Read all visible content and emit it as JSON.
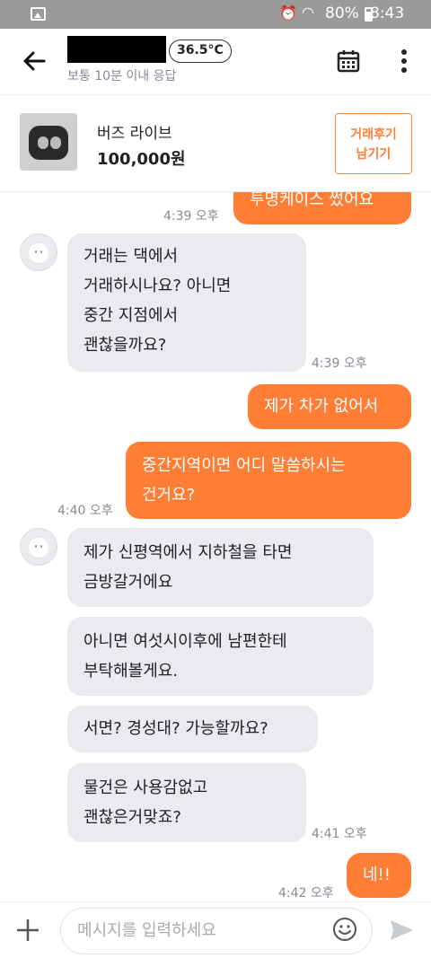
{
  "status_bar": {
    "battery": "80%",
    "time": "8:43"
  },
  "header": {
    "temperature": "36.5°C",
    "response_time": "보통 10분 이내 응답"
  },
  "product": {
    "title": "버즈 라이브",
    "price": "100,000원",
    "review_button": [
      "거래후기",
      "남기기"
    ]
  },
  "messages": [
    {
      "sender": "me",
      "lines": [
        "투명케이스 썼어요"
      ],
      "time": "4:39 오후"
    },
    {
      "sender": "them",
      "lines": [
        "거래는 댁에서",
        "거래하시나요? 아니면",
        "중간 지점에서",
        "괜찮을까요?"
      ],
      "time": "4:39 오후"
    },
    {
      "sender": "me",
      "lines": [
        "제가 차가 없어서"
      ]
    },
    {
      "sender": "me",
      "lines": [
        "중간지역이면 어디 말씀하시는",
        "건거요?"
      ],
      "time": "4:40 오후"
    },
    {
      "sender": "them",
      "lines": [
        "제가 신평역에서 지하철을 타면",
        "금방갈거에요"
      ]
    },
    {
      "sender": "them",
      "lines": [
        "아니면 여섯시이후에 남편한테",
        "부탁해볼게요."
      ]
    },
    {
      "sender": "them",
      "lines": [
        "서면? 경성대? 가능할까요?"
      ]
    },
    {
      "sender": "them",
      "lines": [
        "물건은 사용감없고",
        "괜찮은거맞죠?"
      ],
      "time": "4:41 오후"
    },
    {
      "sender": "me",
      "lines": [
        "네!!"
      ],
      "time": "4:42 오후"
    }
  ],
  "input": {
    "placeholder": "메시지를 입력하세요"
  },
  "colors": {
    "accent": "#ff7e36",
    "incoming_bubble": "#eaebee",
    "muted_text": "#868b94"
  },
  "icons": [
    "back-arrow-icon",
    "calendar-icon",
    "more-vertical-icon",
    "plus-icon",
    "emoji-icon",
    "send-icon"
  ]
}
